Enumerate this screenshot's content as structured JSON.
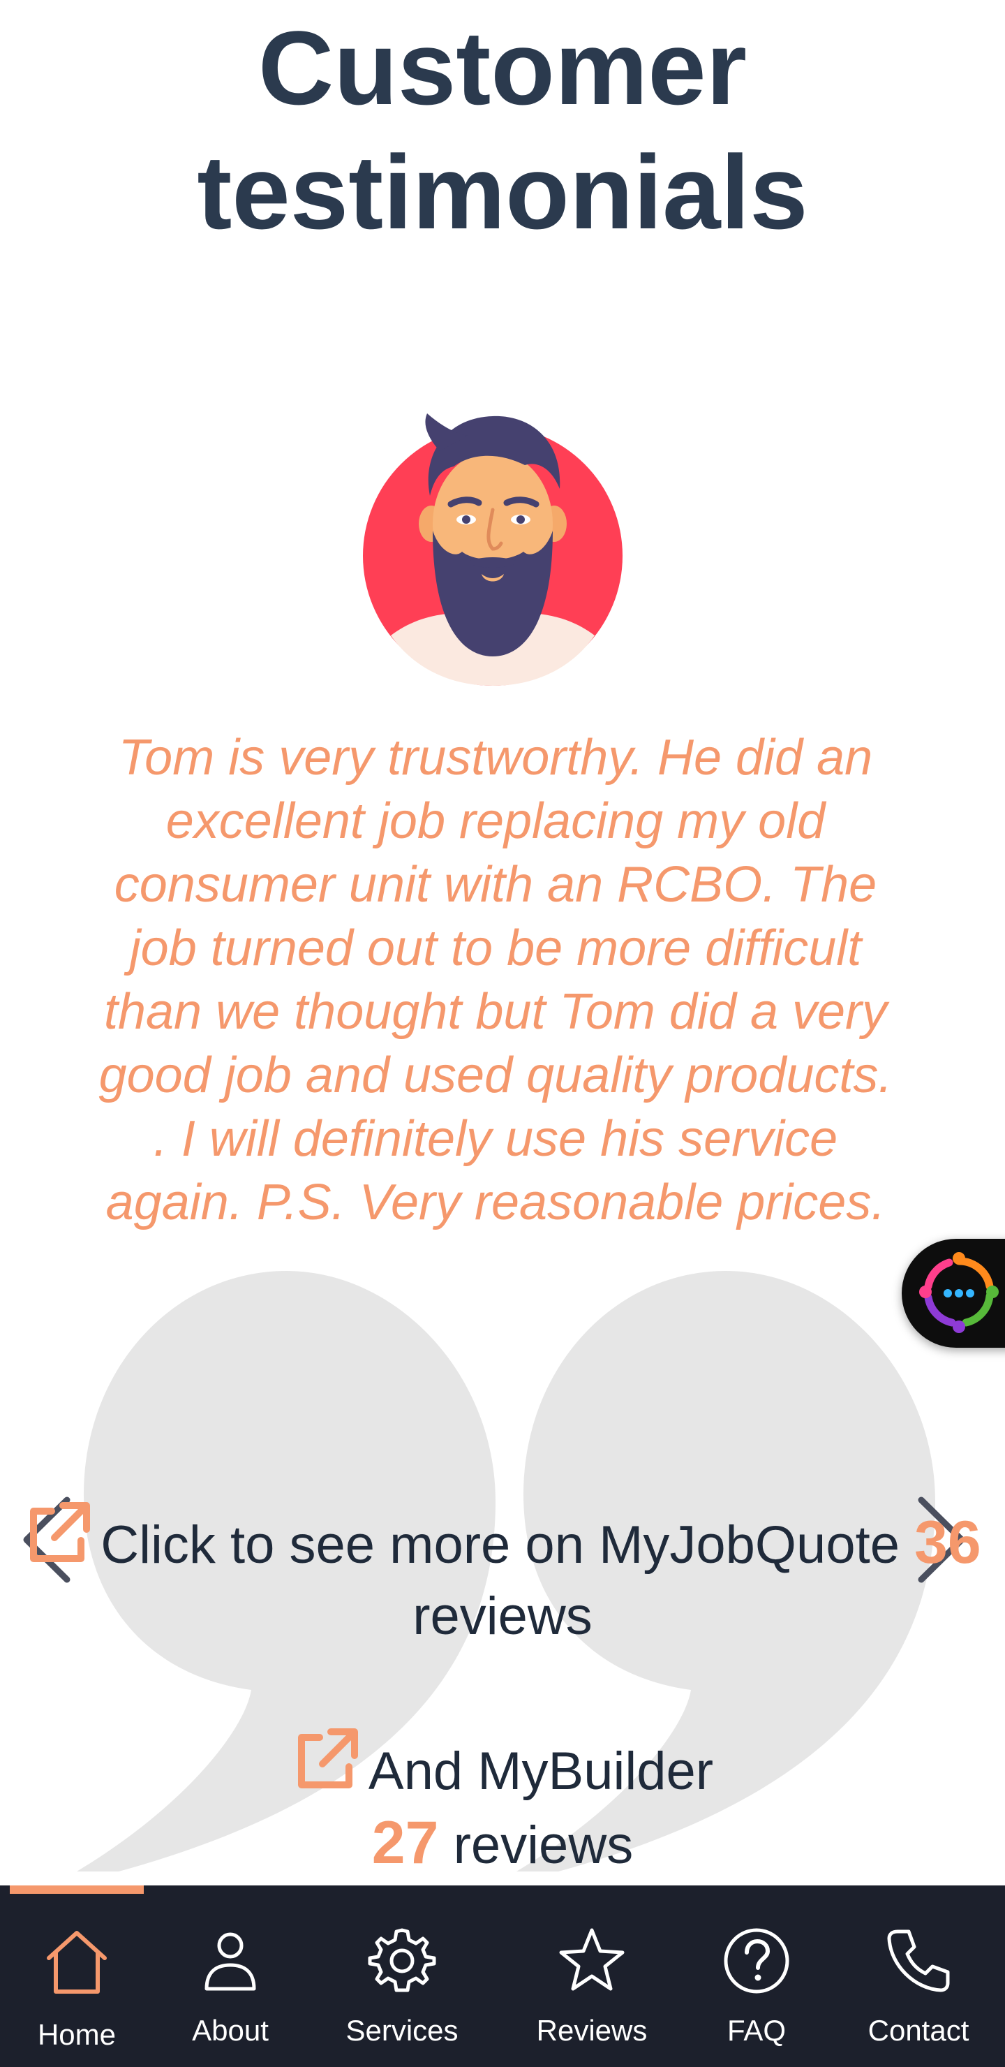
{
  "page_title_line1": "Customer",
  "page_title_line2": "testimonials",
  "testimonial": {
    "text": "Tom is very trustworthy. He did an excellent job replacing my old consumer unit with an RCBO. The job turned out to be more difficult than we thought but Tom did a very good job and used quality products. . I will definitely use his service again. P.S. Very reasonable prices."
  },
  "reviews": {
    "mjq": {
      "prefix": "Click to see more on MyJobQuote ",
      "count": "36",
      "suffix": " reviews"
    },
    "mb": {
      "prefix": "And MyBuilder ",
      "count": "27",
      "suffix": " reviews"
    }
  },
  "carousel": {
    "prev_icon": "chevron-left-icon",
    "next_icon": "chevron-right-icon"
  },
  "chat_widget": {
    "icon": "chat-bubble-icon"
  },
  "nav": {
    "home": "Home",
    "about": "About",
    "services": "Services",
    "reviews": "Reviews",
    "faq": "FAQ",
    "contact": "Contact"
  },
  "colors": {
    "title": "#2b3a4e",
    "accent": "#f5986c",
    "nav_background": "#1c202c",
    "quote_mark": "#e6e6e6"
  }
}
